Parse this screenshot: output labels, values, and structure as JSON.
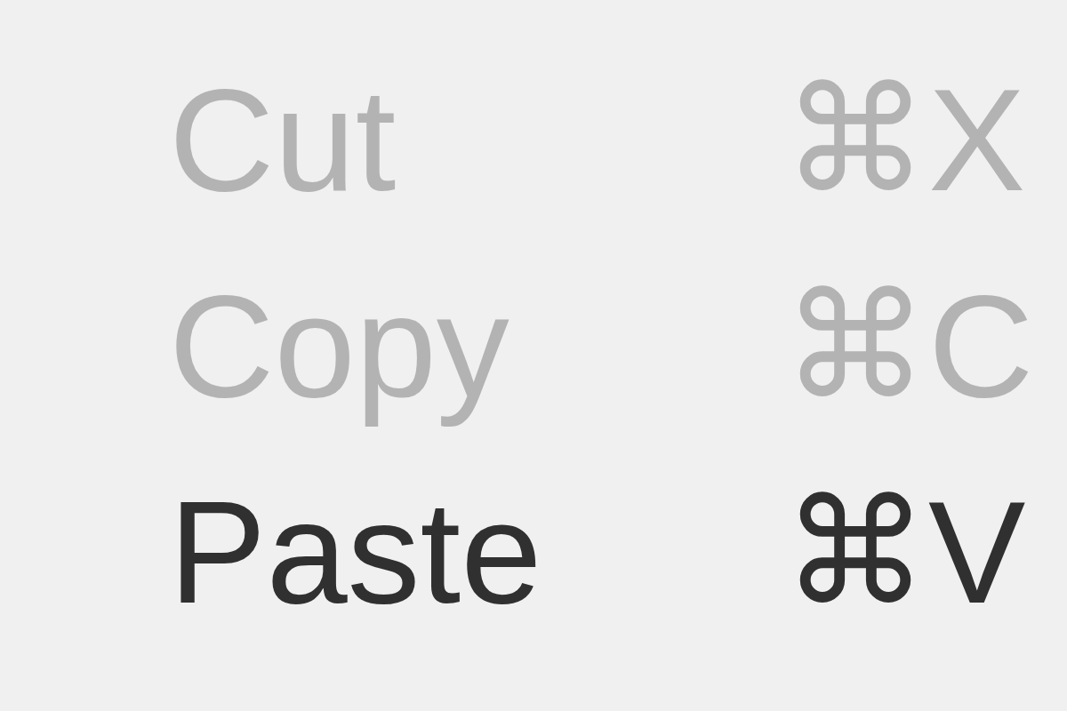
{
  "menu": {
    "items": [
      {
        "label": "Cut",
        "shortcut": "⌘X",
        "disabled": true
      },
      {
        "label": "Copy",
        "shortcut": "⌘C",
        "disabled": true
      },
      {
        "label": "Paste",
        "shortcut": "⌘V",
        "disabled": false
      }
    ]
  }
}
